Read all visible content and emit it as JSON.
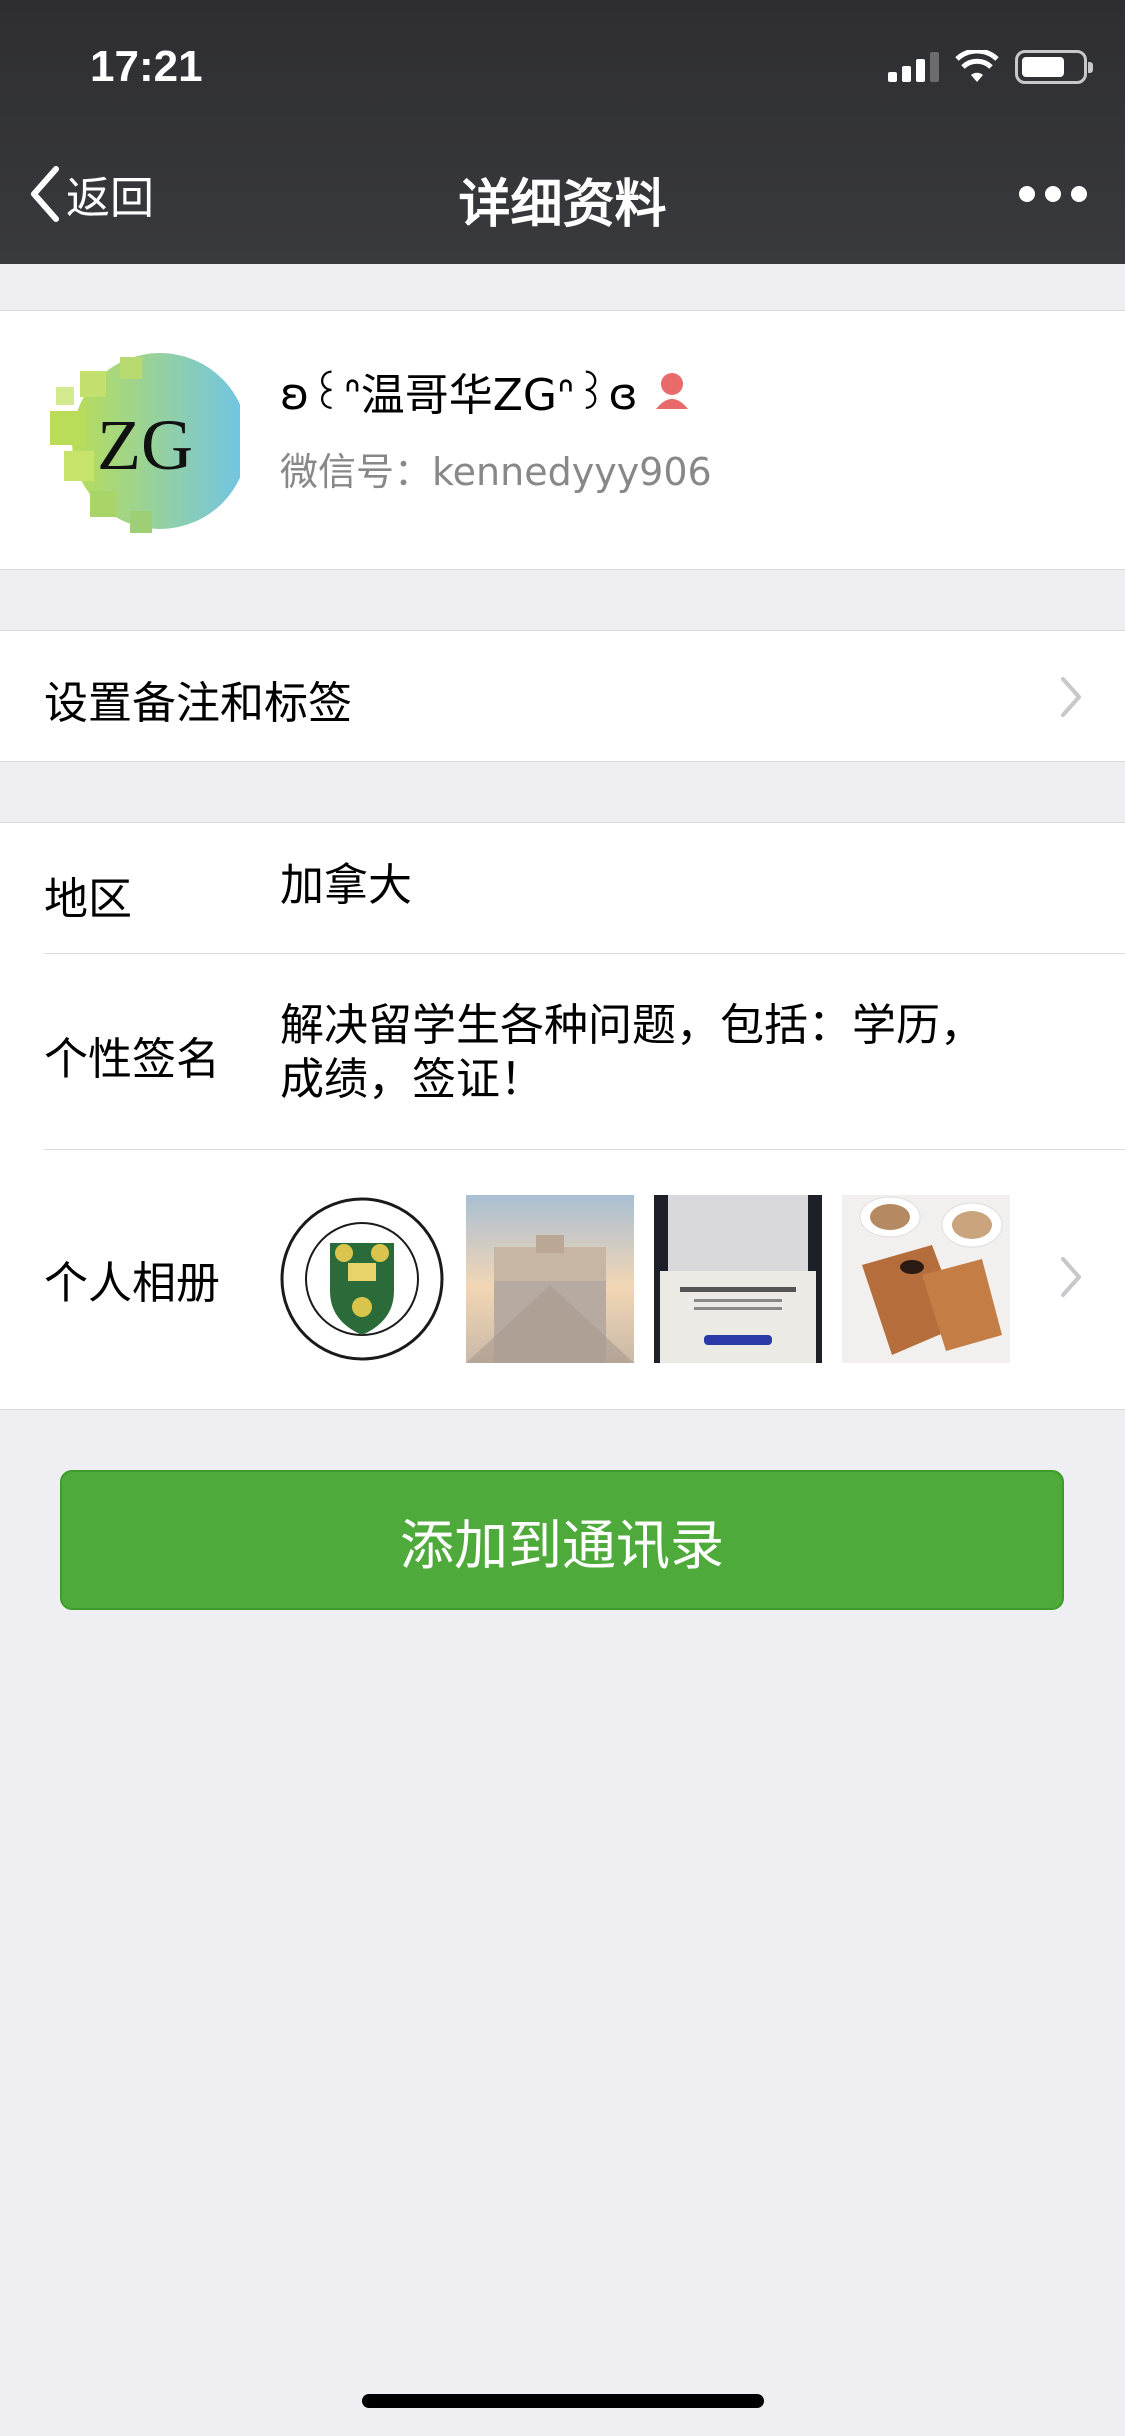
{
  "status_bar": {
    "time": "17:21"
  },
  "nav": {
    "back_label": "返回",
    "title": "详细资料"
  },
  "profile": {
    "name": "温哥华ZG",
    "name_decor_left": "ʚ꒰ᐢ",
    "name_decor_right": "ᐢ꒱ɞ",
    "wechat_id_label": "微信号：",
    "wechat_id": "kennedyyy906",
    "avatar_text": "ZG",
    "gender": "female"
  },
  "remark_row": {
    "label": "设置备注和标签"
  },
  "details": {
    "region_label": "地区",
    "region_value": "加拿大",
    "signature_label": "个性签名",
    "signature_value": "解决留学生各种问题，包括：学历，成绩，签证！",
    "album_label": "个人相册",
    "album_photos": [
      {
        "name": "university-seal-photo",
        "alt": "UNIVERSITY OF SASKATCHEWAN"
      },
      {
        "name": "chateau-photo"
      },
      {
        "name": "diploma-photo",
        "alt": "The University of British Columbia"
      },
      {
        "name": "waffle-coffee-photo"
      }
    ]
  },
  "actions": {
    "add_contact": "添加到通讯录"
  },
  "colors": {
    "nav_bg": "#393a3e",
    "accent_green": "#4eaa3a",
    "page_bg": "#eeeef3",
    "gender_icon": "#e86a6a"
  }
}
